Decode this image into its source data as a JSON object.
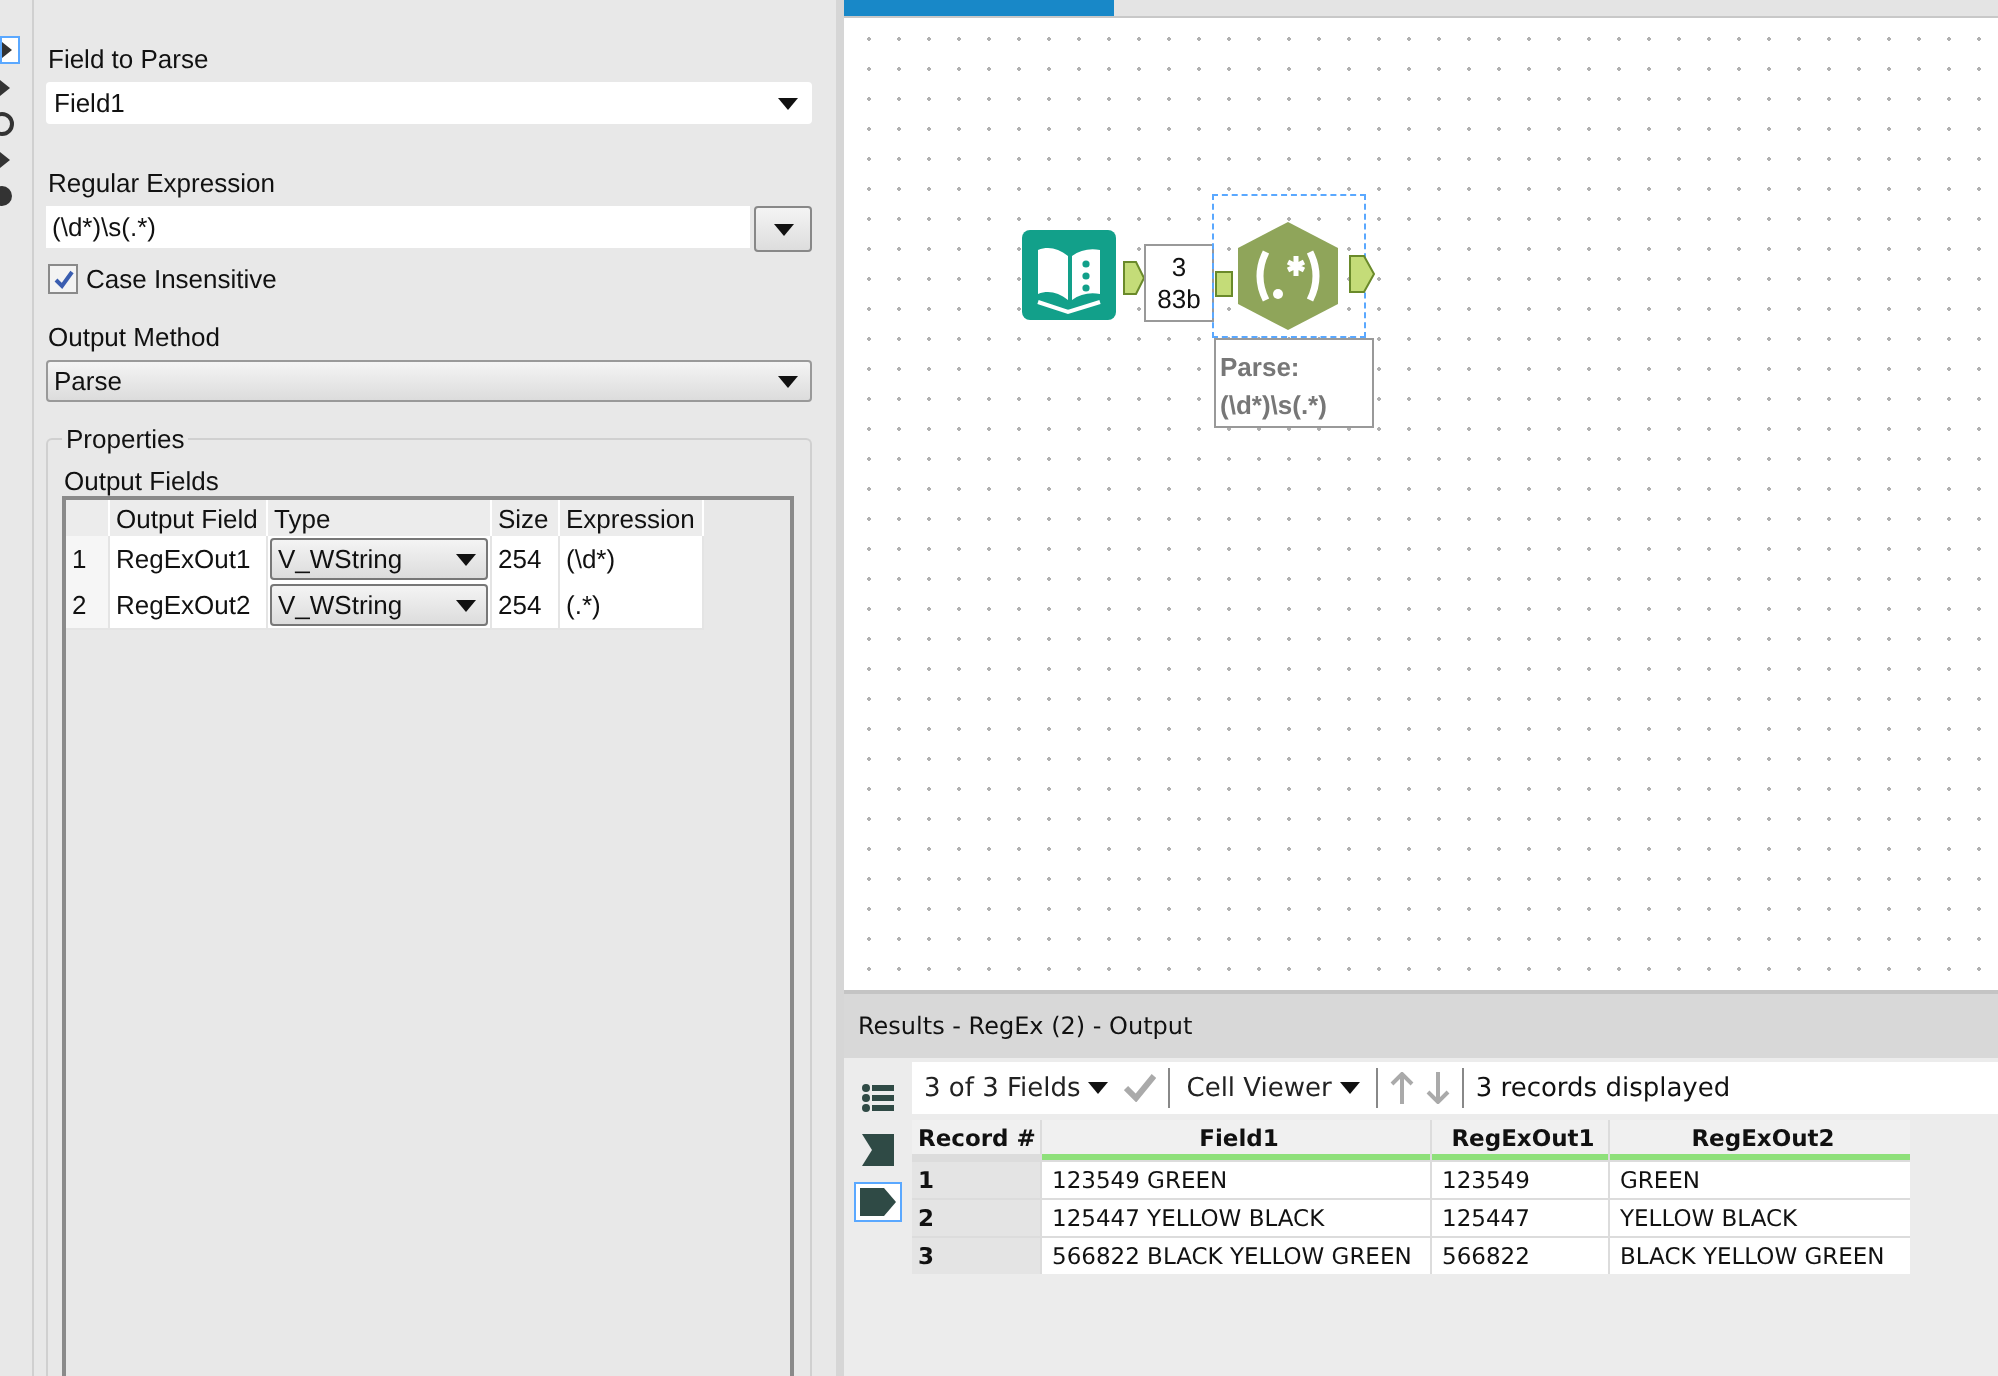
{
  "config": {
    "field_to_parse": {
      "label": "Field to Parse",
      "value": "Field1"
    },
    "regex": {
      "label": "Regular Expression",
      "value": "(\\d*)\\s(.*)"
    },
    "case_insensitive": {
      "label": "Case Insensitive",
      "checked": true
    },
    "output_method": {
      "label": "Output Method",
      "value": "Parse"
    },
    "properties": {
      "title": "Properties",
      "grid_title": "Output Fields",
      "columns": [
        "Output Field",
        "Type",
        "Size",
        "Expression"
      ],
      "rows": [
        {
          "index": "1",
          "output_field": "RegExOut1",
          "type": "V_WString",
          "size": "254",
          "expression": "(\\d*)"
        },
        {
          "index": "2",
          "output_field": "RegExOut2",
          "type": "V_WString",
          "size": "254",
          "expression": "(.*)"
        }
      ]
    }
  },
  "canvas": {
    "connection": {
      "records": "3",
      "size": "83b"
    },
    "tool_annotation": {
      "title": "Parse:",
      "expression": "(\\d*)\\s(.*)"
    }
  },
  "results": {
    "title": "Results - RegEx (2) - Output",
    "fields_selector": "3 of 3 Fields",
    "viewer": "Cell Viewer",
    "status": "3 records displayed",
    "view_buttons": [
      {
        "kind": "list",
        "selected": false
      },
      {
        "kind": "flag",
        "selected": false
      },
      {
        "kind": "tag",
        "selected": true
      }
    ],
    "columns": [
      "Record #",
      "Field1",
      "RegExOut1",
      "RegExOut2"
    ],
    "rows": [
      {
        "cells": [
          "1",
          "123549 GREEN",
          "123549",
          "GREEN"
        ]
      },
      {
        "cells": [
          "2",
          "125447 YELLOW BLACK",
          "125447",
          "YELLOW BLACK"
        ]
      },
      {
        "cells": [
          "3",
          "566822 BLACK YELLOW GREEN",
          "566822",
          "BLACK YELLOW GREEN"
        ]
      }
    ]
  }
}
